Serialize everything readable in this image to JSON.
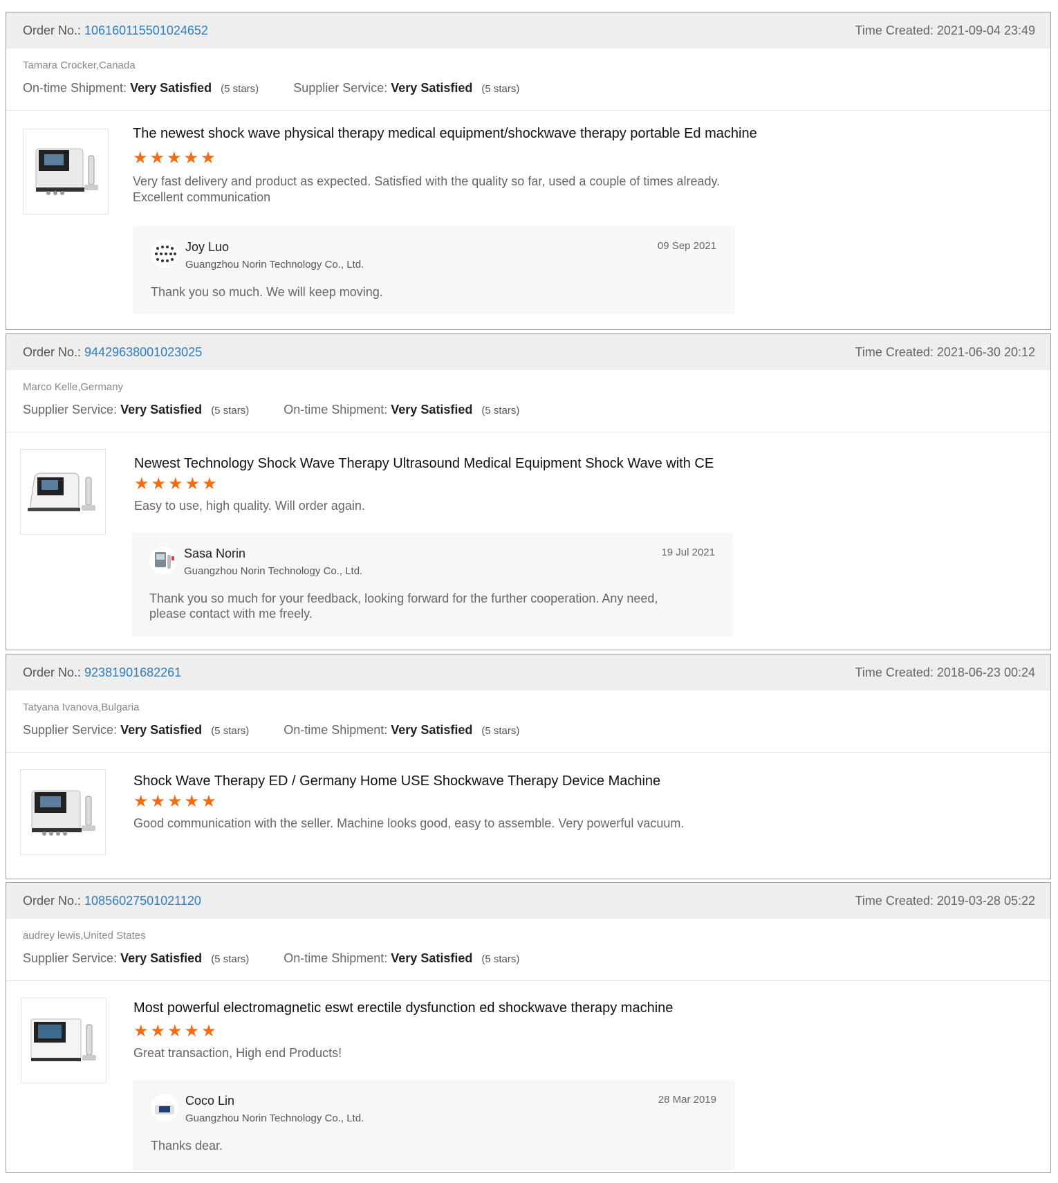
{
  "labels": {
    "order_no": "Order No.: ",
    "time_created": "Time Created: ",
    "stars_suffix": "(5 stars)"
  },
  "colors": {
    "accent_link": "#2f7dbd",
    "star": "#f26c14",
    "header_bg": "#eeeeee",
    "reply_bg": "#f7f7f7"
  },
  "reviews": [
    {
      "order_no": "106160115501024652",
      "time_created": "Time Created: 2021-09-04 23:49",
      "buyer": "Tamara Crocker,Canada",
      "rating1_label": "On-time Shipment:",
      "rating1_value": "Very Satisfied",
      "rating1_stars": "(5 stars)",
      "rating2_label": "Supplier Service:",
      "rating2_value": "Very Satisfied",
      "rating2_stars": "(5 stars)",
      "product_title": "The newest shock wave physical therapy medical equipment/shockwave therapy portable Ed machine",
      "stars": "★★★★★",
      "star_count": 5,
      "review_text": "Very fast delivery and product as expected. Satisfied with the quality so far, used a couple of times already. Excellent communication",
      "reply": {
        "name": "Joy Luo",
        "company": "Guangzhou Norin Technology Co., Ltd.",
        "date": "09 Sep 2021",
        "text": "Thank you so much. We will keep moving."
      }
    },
    {
      "order_no": "944296380010230 25",
      "time_created": "Time Created: 2021-06-30 20:12",
      "buyer": "Marco Kelle,Germany",
      "rating1_label": "Supplier Service:",
      "rating1_value": "Very Satisfied",
      "rating1_stars": "(5 stars)",
      "rating2_label": "On-time Shipment:",
      "rating2_value": "Very Satisfied",
      "rating2_stars": "(5 stars)",
      "product_title": "Newest Technology Shock Wave Therapy Ultrasound Medical Equipment Shock Wave with CE",
      "stars": "★★★★★",
      "star_count": 5,
      "review_text": "Easy to use, high quality. Will order again.",
      "reply": {
        "name": "Sasa Norin",
        "company": "Guangzhou Norin Technology Co., Ltd.",
        "date": "19 Jul 2021",
        "text": "Thank you so much for your feedback, looking forward for the further cooperation. Any need, please contact with me freely."
      }
    },
    {
      "order_no": "92381901682261",
      "time_created": "Time Created: 2018-06-23 00:24",
      "buyer": "Tatyana Ivanova,Bulgaria",
      "rating1_label": "Supplier Service:",
      "rating1_value": "Very Satisfied",
      "rating1_stars": "(5 stars)",
      "rating2_label": "On-time Shipment:",
      "rating2_value": "Very Satisfied",
      "rating2_stars": "(5 stars)",
      "product_title": "Shock Wave Therapy ED / Germany Home USE Shockwave Therapy Device Machine",
      "stars": "★★★★★",
      "star_count": 5,
      "review_text": "Good communication with the seller. Machine looks good, easy to assemble. Very powerful vacuum."
    },
    {
      "order_no": "108560275010211 20",
      "time_created": "Time Created: 2019-03-28 05:22",
      "buyer": "audrey lewis,United States",
      "rating1_label": "Supplier Service:",
      "rating1_value": "Very Satisfied",
      "rating1_stars": "(5 stars)",
      "rating2_label": "On-time Shipment:",
      "rating2_value": "Very Satisfied",
      "rating2_stars": "(5 stars)",
      "product_title": "Most powerful electromagnetic eswt erectile dysfunction ed shockwave therapy machine",
      "stars": "★★★★★",
      "star_count": 5,
      "review_text": "Great transaction, High end Products!",
      "reply": {
        "name": "Coco Lin",
        "company": "Guangzhou Norin Technology Co., Ltd.",
        "date": "28 Mar 2019",
        "text": "Thanks dear."
      }
    }
  ]
}
